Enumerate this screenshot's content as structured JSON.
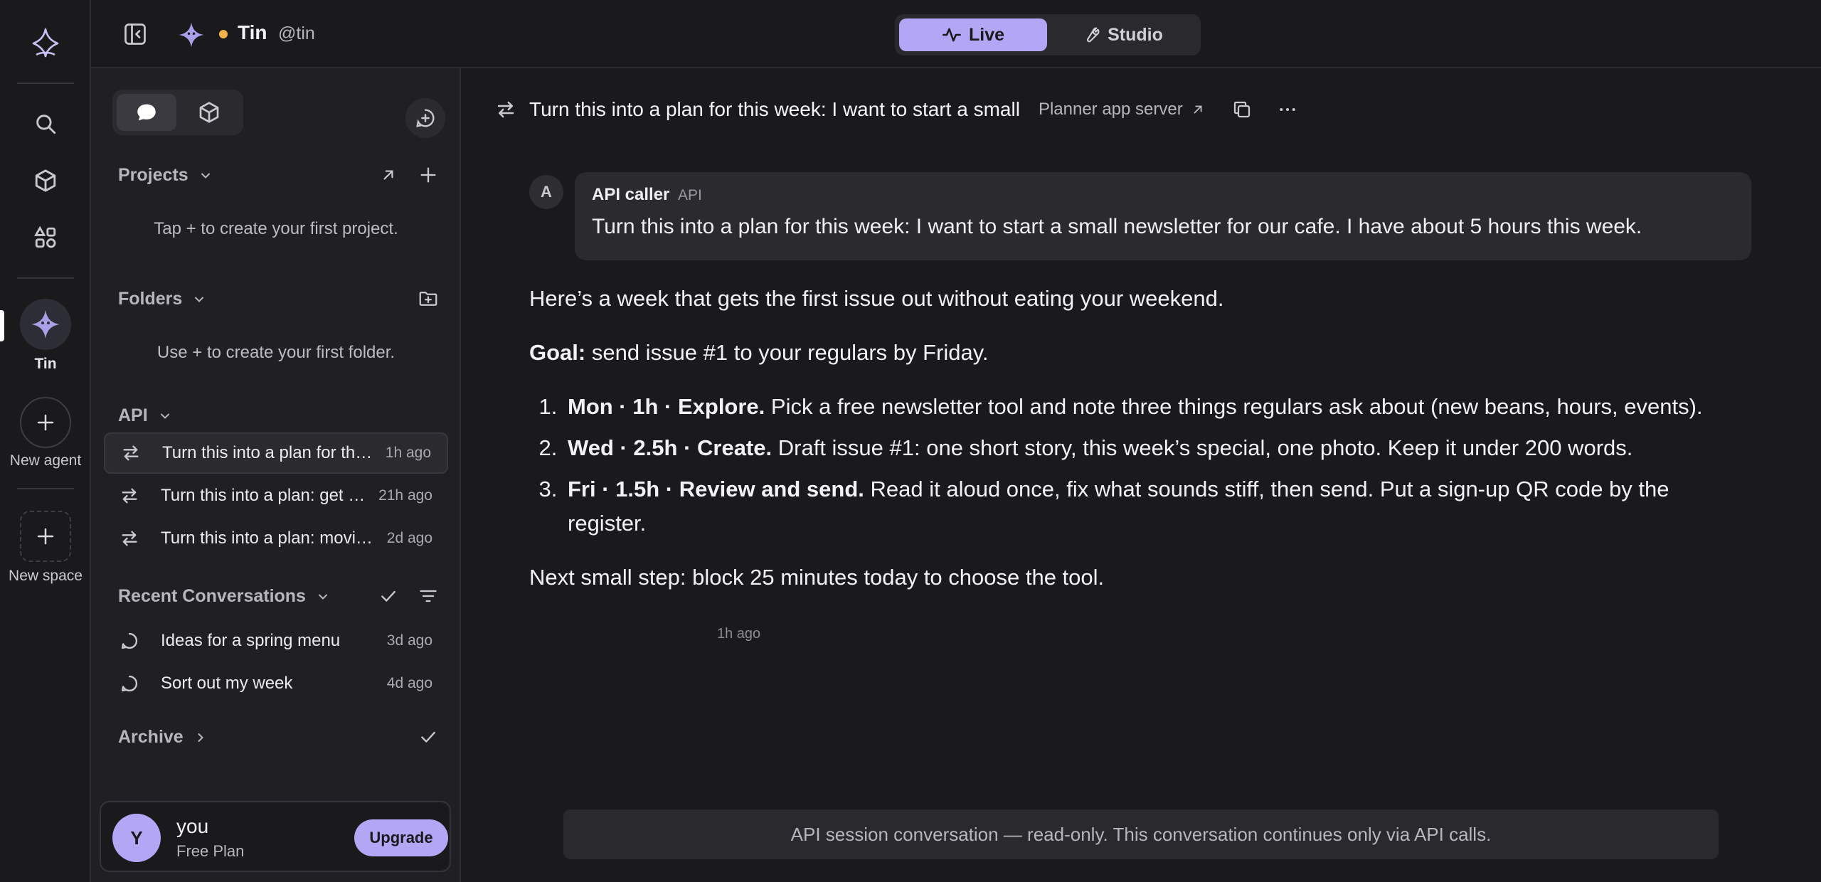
{
  "rail": {
    "agent_label": "Tin",
    "new_agent_label": "New agent",
    "new_space_label": "New space"
  },
  "topbar": {
    "agent_name": "Tin",
    "agent_handle": "@tin",
    "status_color": "#f5b14a",
    "modes": {
      "live": "Live",
      "studio": "Studio"
    },
    "accent": "#b3a6f4"
  },
  "sidebar": {
    "projects": {
      "title": "Projects",
      "hint": "Tap + to create your first project."
    },
    "folders": {
      "title": "Folders",
      "hint": "Use + to create your first folder."
    },
    "api": {
      "title": "API",
      "items": [
        {
          "title": "Turn this into a plan for this week: I want to start a small",
          "time": "1h ago"
        },
        {
          "title": "Turn this into a plan: get organized",
          "time": "21h ago"
        },
        {
          "title": "Turn this into a plan: moving house",
          "time": "2d ago"
        }
      ]
    },
    "recent": {
      "title": "Recent Conversations",
      "items": [
        {
          "title": "Ideas for a spring menu",
          "time": "3d ago"
        },
        {
          "title": "Sort out my week",
          "time": "4d ago"
        }
      ]
    },
    "archive": {
      "title": "Archive"
    },
    "user": {
      "initial": "Y",
      "name": "you",
      "plan": "Free Plan",
      "upgrade": "Upgrade"
    }
  },
  "main": {
    "title": "Turn this into a plan for this week: I want to start a small",
    "server": "Planner app server",
    "message": {
      "avatar": "A",
      "sender": "API caller",
      "tag": "API",
      "text": "Turn this into a plan for this week: I want to start a small newsletter for our cafe. I have about 5 hours this week."
    },
    "reply": {
      "intro": "Here’s a week that gets the first issue out without eating your weekend.",
      "goal_label": "Goal:",
      "goal_text": " send issue #1 to your regulars by Friday.",
      "steps": [
        {
          "head": "Mon · 1h · Explore.",
          "body": " Pick a free newsletter tool and note three things regulars ask about (new beans, hours, events)."
        },
        {
          "head": "Wed · 2.5h · Create.",
          "body": " Draft issue #1: one short story, this week’s special, one photo. Keep it under 200 words."
        },
        {
          "head": "Fri · 1.5h · Review and send.",
          "body": " Read it aloud once, fix what sounds stiff, then send. Put a sign-up QR code by the register."
        }
      ],
      "next": "Next small step: block 25 minutes today to choose the tool.",
      "time": "1h ago"
    },
    "readonly_notice": "API session conversation — read-only. This conversation continues only via API calls."
  }
}
